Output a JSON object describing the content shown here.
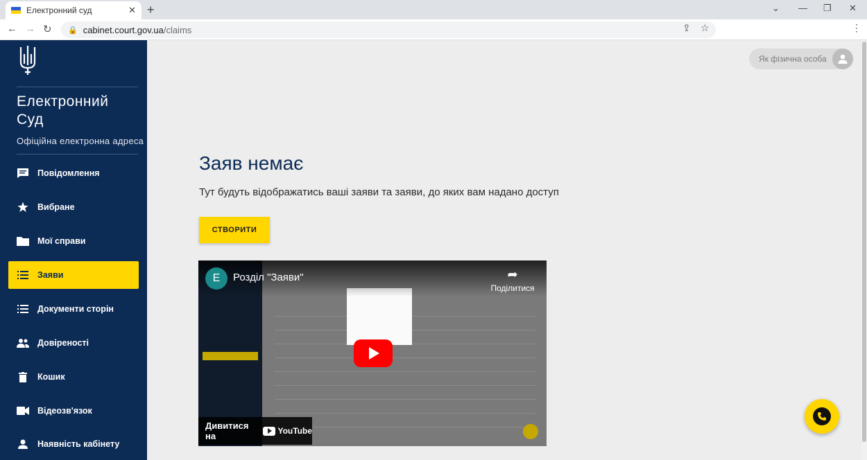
{
  "browser": {
    "tab_title": "Електронний суд",
    "url_domain": "cabinet.court.gov.ua",
    "url_path": "/claims"
  },
  "sidebar": {
    "brand_line1": "Електронний",
    "brand_line2": "Суд",
    "brand_sub": "Офіційна електронна адреса",
    "items": [
      {
        "label": "Повідомлення",
        "icon": "message-icon"
      },
      {
        "label": "Вибране",
        "icon": "star-icon"
      },
      {
        "label": "Мої справи",
        "icon": "folder-icon"
      },
      {
        "label": "Заяви",
        "icon": "list-icon",
        "active": true
      },
      {
        "label": "Документи сторін",
        "icon": "list-icon"
      },
      {
        "label": "Довіреності",
        "icon": "people-icon"
      },
      {
        "label": "Кошик",
        "icon": "trash-icon"
      },
      {
        "label": "Відеозв'язок",
        "icon": "videocam-icon"
      },
      {
        "label": "Наявність кабінету",
        "icon": "person-icon"
      }
    ]
  },
  "header": {
    "user_role": "Як фізична особа"
  },
  "main": {
    "title": "Заяв немає",
    "subtitle": "Тут будуть відображатись ваші заяви та заяви, до яких вам надано доступ",
    "create_label": "СТВОРИТИ"
  },
  "video": {
    "channel_initial": "E",
    "title": "Розділ \"Заяви\"",
    "share_label": "Поділитися",
    "watch_label": "Дивитися на",
    "platform": "YouTube"
  },
  "colors": {
    "sidebar_bg": "#0c2b55",
    "accent": "#ffd600",
    "page_bg": "#ededed"
  }
}
